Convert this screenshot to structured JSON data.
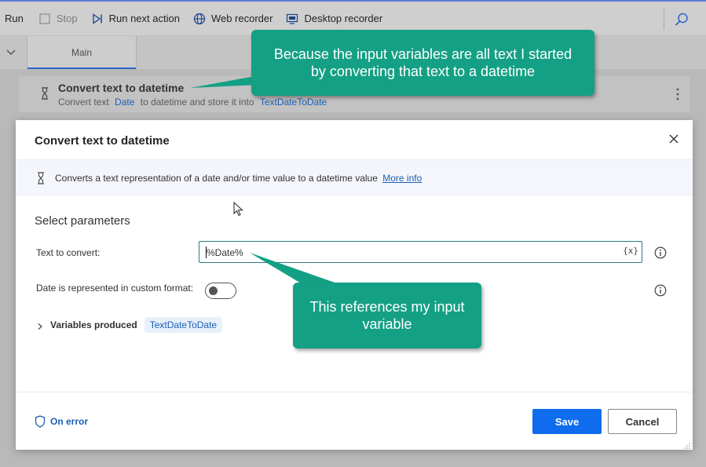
{
  "toolbar": {
    "run_label": "Run",
    "stop_label": "Stop",
    "run_next_label": "Run next action",
    "web_recorder_label": "Web recorder",
    "desktop_recorder_label": "Desktop recorder"
  },
  "tabs": {
    "main_label": "Main"
  },
  "step": {
    "title": "Convert text to datetime",
    "desc_prefix": "Convert text",
    "desc_var": "Date",
    "desc_middle": "to datetime and store it into",
    "desc_output": "TextDateToDate"
  },
  "dialog": {
    "title": "Convert text to datetime",
    "info_text": "Converts a text representation of a date and/or time value to a datetime value",
    "info_link": "More info",
    "section_title": "Select parameters",
    "text_to_convert_label": "Text to convert:",
    "text_to_convert_value": "%Date%",
    "var_button": "{x}",
    "custom_format_label": "Date is represented in custom format:",
    "custom_format_enabled": false,
    "variables_produced_label": "Variables produced",
    "variables_produced": [
      "TextDateToDate"
    ],
    "on_error_label": "On error",
    "save_label": "Save",
    "cancel_label": "Cancel"
  },
  "callouts": {
    "top": "Because the input variables are all text I started by converting that text to a datetime",
    "bottom": "This references my input variable"
  },
  "colors": {
    "accent": "#0f6cef",
    "link": "#1b5fb5",
    "callout": "#14a084"
  }
}
